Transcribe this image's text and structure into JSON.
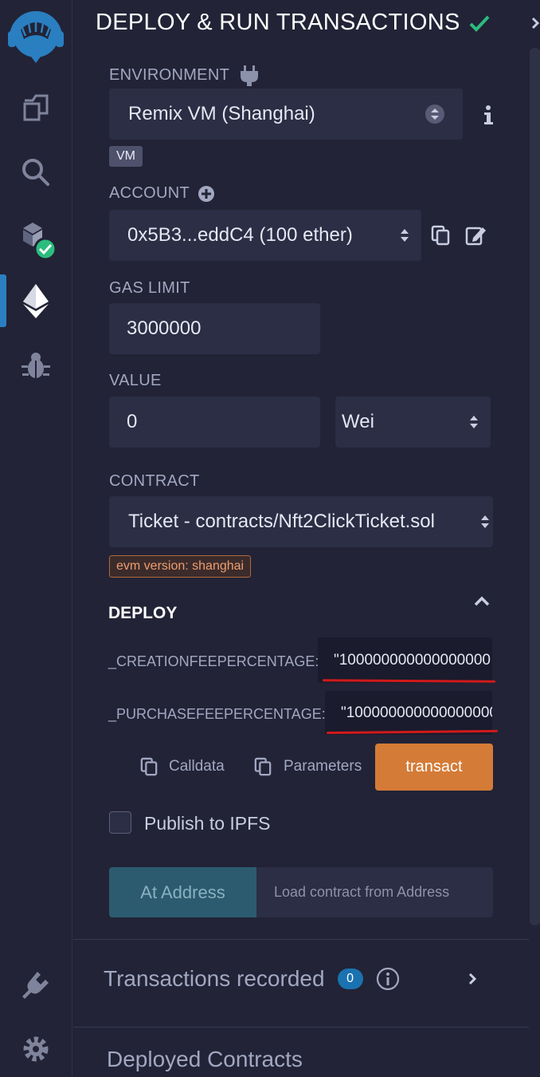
{
  "sidebar": {
    "items": [
      {
        "name": "remix-logo-icon"
      },
      {
        "name": "file-explorer-icon"
      },
      {
        "name": "search-icon"
      },
      {
        "name": "solidity-compiler-icon"
      },
      {
        "name": "deploy-run-icon"
      },
      {
        "name": "debugger-icon"
      },
      {
        "name": "plugin-manager-icon"
      },
      {
        "name": "settings-icon"
      }
    ],
    "accent": "#2a7fc1"
  },
  "panel": {
    "title": "DEPLOY & RUN TRANSACTIONS",
    "environment": {
      "label": "ENVIRONMENT",
      "value": "Remix VM (Shanghai)",
      "badge": "VM"
    },
    "account": {
      "label": "ACCOUNT",
      "value": "0x5B3...eddC4 (100 ether)"
    },
    "gas_limit": {
      "label": "GAS LIMIT",
      "value": "3000000"
    },
    "value": {
      "label": "VALUE",
      "amount": "0",
      "unit": "Wei"
    },
    "contract": {
      "label": "CONTRACT",
      "value": "Ticket - contracts/Nft2ClickTicket.sol",
      "evm_badge": "evm version: shanghai"
    },
    "deploy": {
      "title": "DEPLOY",
      "params": [
        {
          "label": "_CREATIONFEEPERCENTAGE:",
          "value": "\"100000000000000000"
        },
        {
          "label": "_PURCHASEFEEPERCENTAGE:",
          "value": "\"100000000000000000"
        }
      ],
      "calldata_label": "Calldata",
      "parameters_label": "Parameters",
      "transact_label": "transact",
      "transact_color": "#d47b37"
    },
    "publish_ipfs_label": "Publish to IPFS",
    "at_address": {
      "button_label": "At Address",
      "placeholder": "Load contract from Address"
    },
    "transactions_recorded": {
      "label": "Transactions recorded",
      "count": "0"
    },
    "deployed_contracts": {
      "label": "Deployed Contracts"
    }
  }
}
